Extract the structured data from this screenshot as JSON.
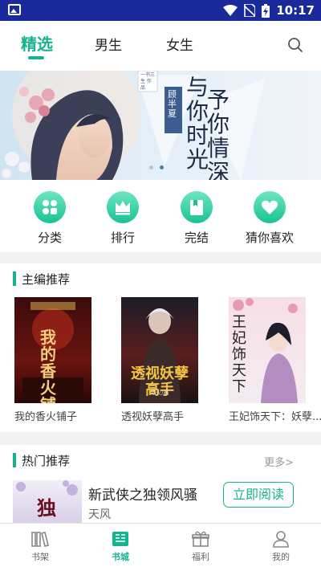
{
  "status_bar": {
    "time": "10:17"
  },
  "top_tabs": [
    {
      "label": "精选",
      "active": true
    },
    {
      "label": "男生",
      "active": false
    },
    {
      "label": "女生",
      "active": false
    }
  ],
  "banner": {
    "title_left": "与你时光",
    "title_right": "予你情深",
    "author": "顾半夏",
    "tag": "一书三生 作品"
  },
  "quick_entries": [
    {
      "label": "分类",
      "icon": "category-icon"
    },
    {
      "label": "排行",
      "icon": "crown-icon"
    },
    {
      "label": "完结",
      "icon": "book-icon"
    },
    {
      "label": "猜你喜欢",
      "icon": "heart-icon"
    }
  ],
  "editor_picks": {
    "title": "主编推荐",
    "books": [
      {
        "name": "我的香火铺子",
        "cover_text": "我的香火铺子"
      },
      {
        "name": "透视妖孽高手",
        "cover_text": "透视妖孽高手",
        "cover_author": "焰火/著"
      },
      {
        "name": "王妃饰天下：妖孽...",
        "cover_text": "王妃饰天下"
      }
    ]
  },
  "hot_picks": {
    "title": "热门推荐",
    "more": "更多>",
    "book": {
      "title": "新武侠之独领风骚",
      "author": "天风",
      "button": "立即阅读",
      "cover_text": "独"
    }
  },
  "bottom_nav": [
    {
      "label": "书架",
      "icon": "bookshelf-icon",
      "active": false
    },
    {
      "label": "书城",
      "icon": "bookstore-icon",
      "active": true
    },
    {
      "label": "福利",
      "icon": "gift-icon",
      "active": false
    },
    {
      "label": "我的",
      "icon": "user-icon",
      "active": false
    }
  ],
  "colors": {
    "accent": "#17b38f",
    "status_bar": "#1a2a9a"
  }
}
